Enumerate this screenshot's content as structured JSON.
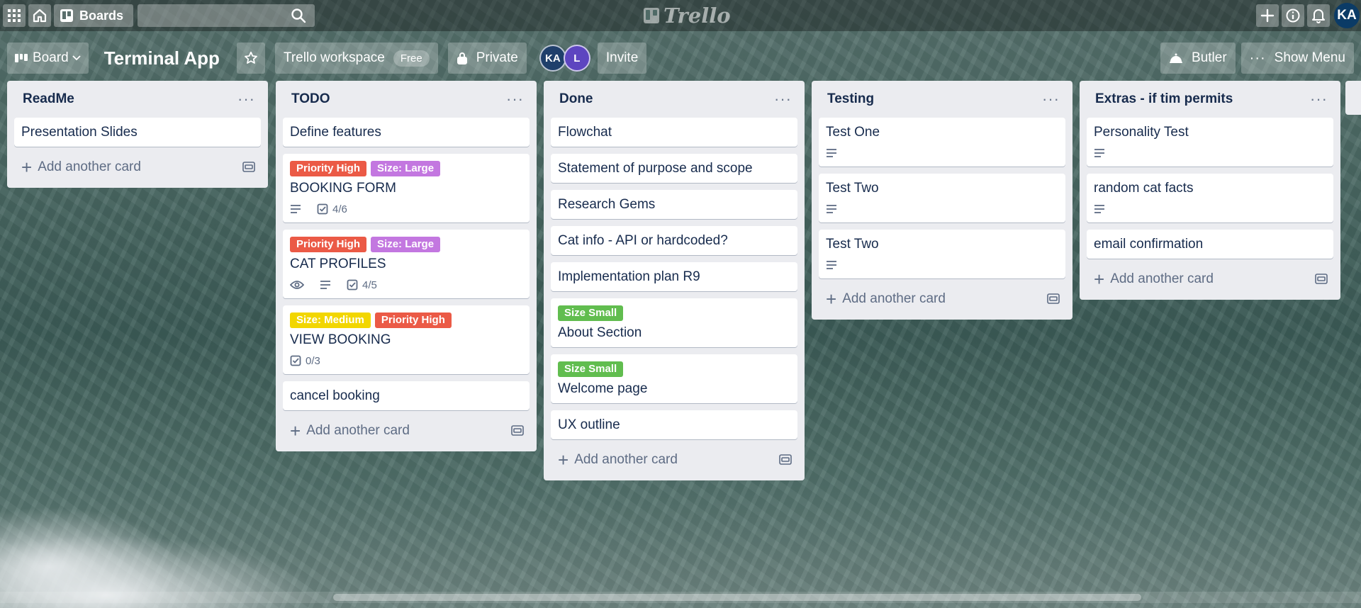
{
  "header": {
    "boards_label": "Boards",
    "logo_text": "Trello",
    "user_initials": "KA"
  },
  "board": {
    "view_label": "Board",
    "title": "Terminal App",
    "workspace_label": "Trello workspace",
    "workspace_plan": "Free",
    "visibility_label": "Private",
    "members": [
      "KA",
      "L"
    ],
    "invite_label": "Invite",
    "butler_label": "Butler",
    "show_menu_label": "Show Menu"
  },
  "add_card_label": "Add another card",
  "label_colors": {
    "red": "#eb5a46",
    "purple": "#c377e0",
    "yellow": "#f2d600",
    "green": "#61bd4f"
  },
  "lists": [
    {
      "title": "ReadMe",
      "cards": [
        {
          "title": "Presentation Slides"
        }
      ]
    },
    {
      "title": "TODO",
      "cards": [
        {
          "title": "Define features"
        },
        {
          "title": "BOOKING FORM",
          "labels": [
            "Priority High",
            "Size: Large"
          ],
          "checklist": "4/6"
        },
        {
          "title": "CAT PROFILES",
          "labels": [
            "Priority High",
            "Size: Large"
          ],
          "checklist": "4/5"
        },
        {
          "title": "VIEW BOOKING",
          "labels": [
            "Size: Medium",
            "Priority High"
          ],
          "checklist": "0/3"
        },
        {
          "title": "cancel booking"
        }
      ]
    },
    {
      "title": "Done",
      "cards": [
        {
          "title": "Flowchat"
        },
        {
          "title": "Statement of purpose and scope"
        },
        {
          "title": "Research Gems"
        },
        {
          "title": "Cat info - API or hardcoded?"
        },
        {
          "title": "Implementation plan R9"
        },
        {
          "title": "About Section",
          "labels": [
            "Size Small"
          ]
        },
        {
          "title": "Welcome page",
          "labels": [
            "Size Small"
          ]
        },
        {
          "title": "UX outline"
        }
      ]
    },
    {
      "title": "Testing",
      "cards": [
        {
          "title": "Test One"
        },
        {
          "title": "Test Two"
        },
        {
          "title": "Test Two"
        }
      ]
    },
    {
      "title": "Extras - if tim permits",
      "cards": [
        {
          "title": "Personality Test"
        },
        {
          "title": "random cat facts"
        },
        {
          "title": "email confirmation"
        }
      ]
    }
  ]
}
